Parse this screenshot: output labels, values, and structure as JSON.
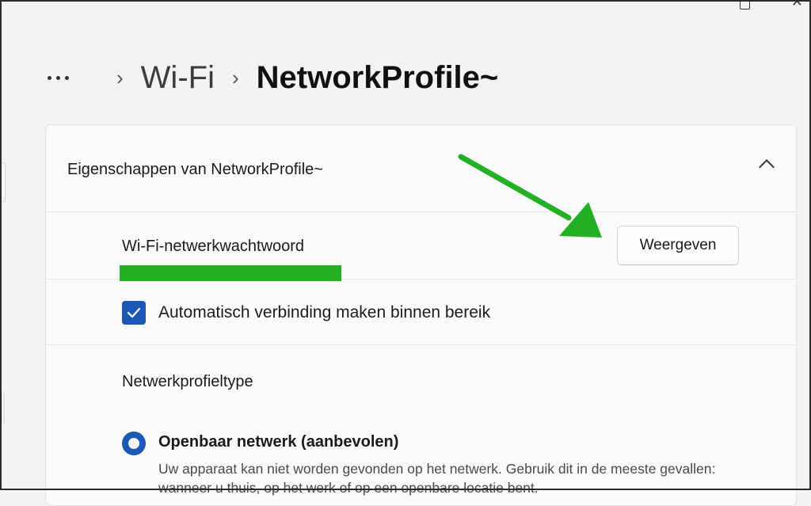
{
  "breadcrumb": {
    "more_icon": "more-horizontal-icon",
    "parent": "Wi-Fi",
    "current": "NetworkProfile~"
  },
  "card": {
    "title": "Eigenschappen van NetworkProfile~",
    "expanded": true
  },
  "password_row": {
    "label": "Wi-Fi-netwerkwachtwoord",
    "button_label": "Weergeven"
  },
  "auto_connect": {
    "label": "Automatisch verbinding maken binnen bereik",
    "checked": true
  },
  "profile_type": {
    "label": "Netwerkprofieltype",
    "options": [
      {
        "title": "Openbaar netwerk (aanbevolen)",
        "description": "Uw apparaat kan niet worden gevonden op het netwerk. Gebruik dit in de meeste gevallen: wanneer u thuis, op het werk of op een openbare locatie bent.",
        "selected": true
      }
    ]
  },
  "colors": {
    "accent": "#1b57b4",
    "annotation_green": "#24b024",
    "background": "#f3f3f3",
    "card": "#fbfbfb"
  }
}
